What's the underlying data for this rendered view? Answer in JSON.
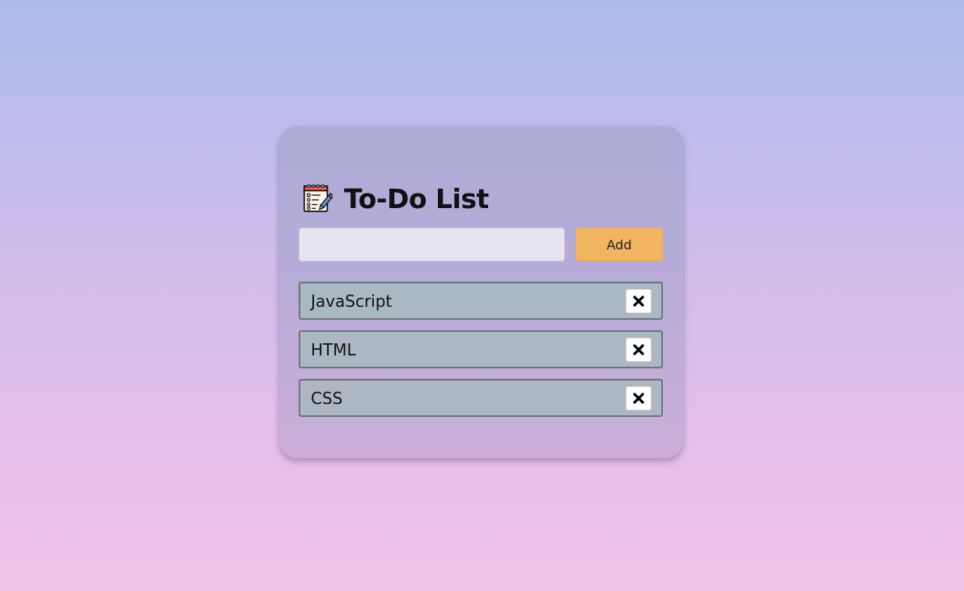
{
  "app": {
    "title": "To-Do List",
    "icon": "notepad-checklist-icon"
  },
  "input": {
    "value": "",
    "placeholder": ""
  },
  "add_button": {
    "label": "Add"
  },
  "tasks": [
    {
      "text": "JavaScript",
      "delete_icon": "close-icon"
    },
    {
      "text": "HTML",
      "delete_icon": "close-icon"
    },
    {
      "text": "CSS",
      "delete_icon": "close-icon"
    }
  ],
  "colors": {
    "background_top": "#abbcec",
    "background_bottom": "#f3c1ea",
    "card": "#b9acd9",
    "add_button": "#f1b461",
    "task_item": "#a9b8c2",
    "task_border": "#6b747a",
    "input": "#e7e4f1"
  }
}
